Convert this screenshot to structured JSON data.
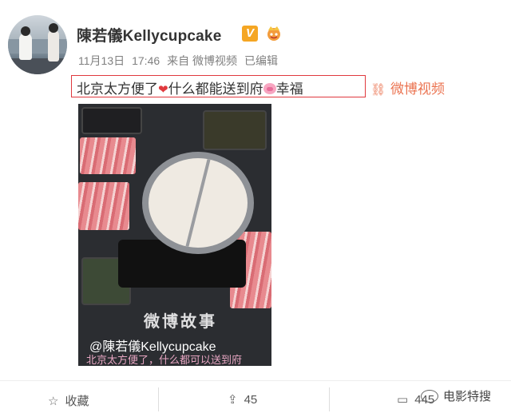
{
  "post": {
    "username": "陳若儀Kellycupcake",
    "badge": "V",
    "date": "11月13日",
    "time": "17:46",
    "source": "来自 微博视频",
    "edited": "已编辑",
    "text_part1": "北京太方便了",
    "heart": "❤",
    "text_part2": "什么都能送到府",
    "text_part3": "幸福",
    "link_icon": "⛓",
    "video_link": "微博视频"
  },
  "media": {
    "watermark": "微博故事",
    "user_overlay": "@陳若儀Kellycupcake",
    "caption_overlay": "北京太方便了，什么都可以送到府"
  },
  "actions": {
    "favorite_icon": "☆",
    "favorite": "收藏",
    "share_icon": "⇪",
    "share_count": "45",
    "comment_icon": "▭",
    "comment_count": "445"
  },
  "wechat_watermark": "电影特搜",
  "colors": {
    "accent": "#eb7350",
    "highlight_border": "#e0393e",
    "badge": "#f5a623"
  }
}
